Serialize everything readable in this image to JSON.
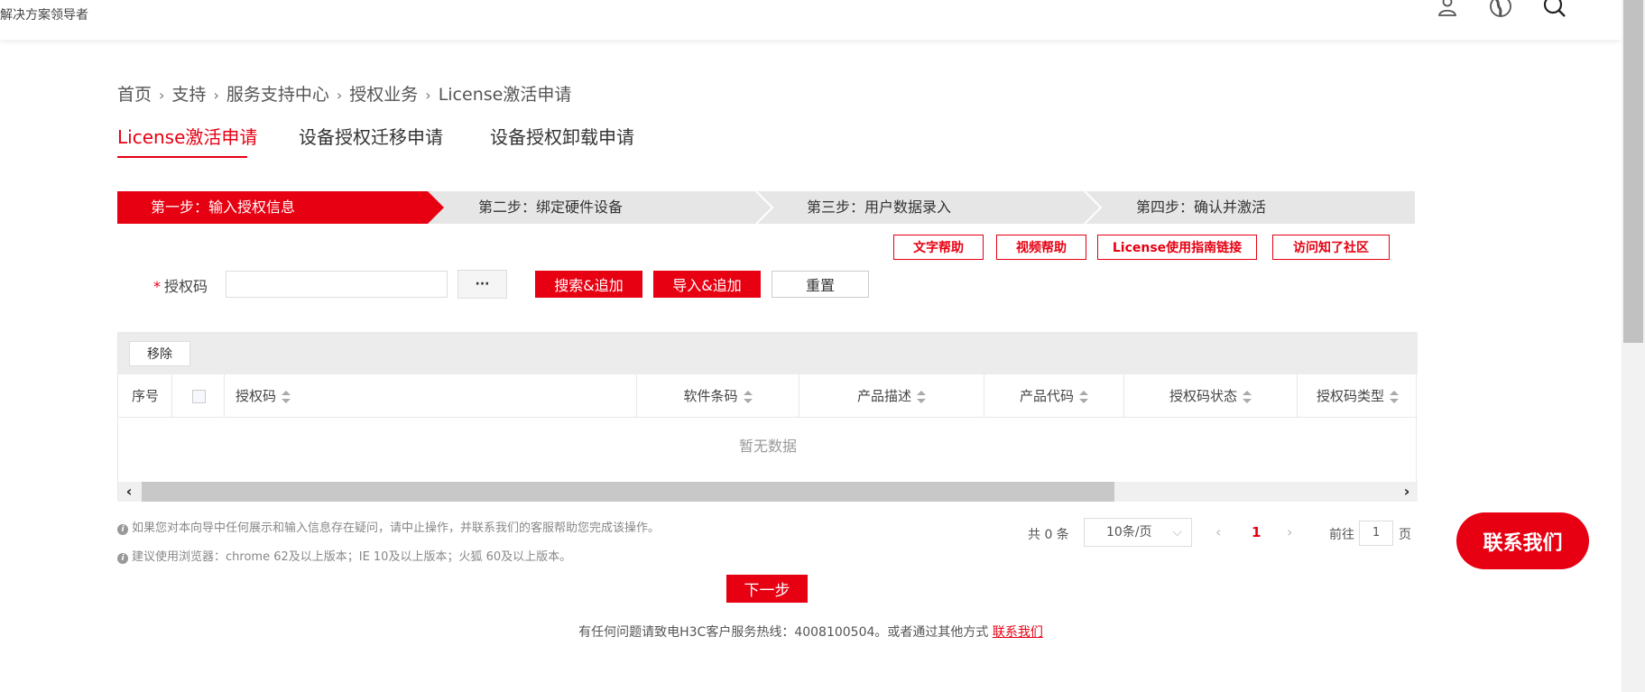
{
  "header": {
    "slogan": "解决方案领导者",
    "icons": [
      "user-icon",
      "globe-icon",
      "search-icon"
    ]
  },
  "breadcrumb": [
    "首页",
    "支持",
    "服务支持中心",
    "授权业务",
    "License激活申请"
  ],
  "tabs": [
    {
      "label": "License激活申请",
      "active": true
    },
    {
      "label": "设备授权迁移申请",
      "active": false
    },
    {
      "label": "设备授权卸载申请",
      "active": false
    }
  ],
  "steps": [
    {
      "label": "第一步：输入授权信息",
      "active": true
    },
    {
      "label": "第二步：绑定硬件设备",
      "active": false
    },
    {
      "label": "第三步：用户数据录入",
      "active": false
    },
    {
      "label": "第四步：确认并激活",
      "active": false
    }
  ],
  "help_buttons": [
    "文字帮助",
    "视频帮助",
    "License使用指南链接",
    "访问知了社区"
  ],
  "form": {
    "required_mark": "*",
    "label": "授权码",
    "input_value": "",
    "dots_label": "···",
    "search_add": "搜索&追加",
    "import_add": "导入&追加",
    "reset": "重置"
  },
  "table": {
    "remove_label": "移除",
    "columns": [
      "序号",
      "授权码",
      "软件条码",
      "产品描述",
      "产品代码",
      "授权码状态",
      "授权码类型"
    ],
    "empty_text": "暂无数据"
  },
  "notes": [
    "如果您对本向导中任何展示和输入信息存在疑问，请中止操作，并联系我们的客服帮助您完成该操作。",
    "建议使用浏览器：chrome 62及以上版本；IE 10及以上版本；火狐 60及以上版本。"
  ],
  "pagination": {
    "total": "共 0 条",
    "page_size": "10条/页",
    "current_page": "1",
    "goto_label": "前往",
    "goto_value": "1",
    "page_suffix": "页"
  },
  "next_button": "下一步",
  "footer": {
    "text": "有任何问题请致电H3C客户服务热线：4008100504。或者通过其他方式 ",
    "link": "联系我们"
  },
  "contact_float": "联系我们",
  "colors": {
    "accent": "#e60012",
    "step_bg": "#e6e6e6"
  }
}
